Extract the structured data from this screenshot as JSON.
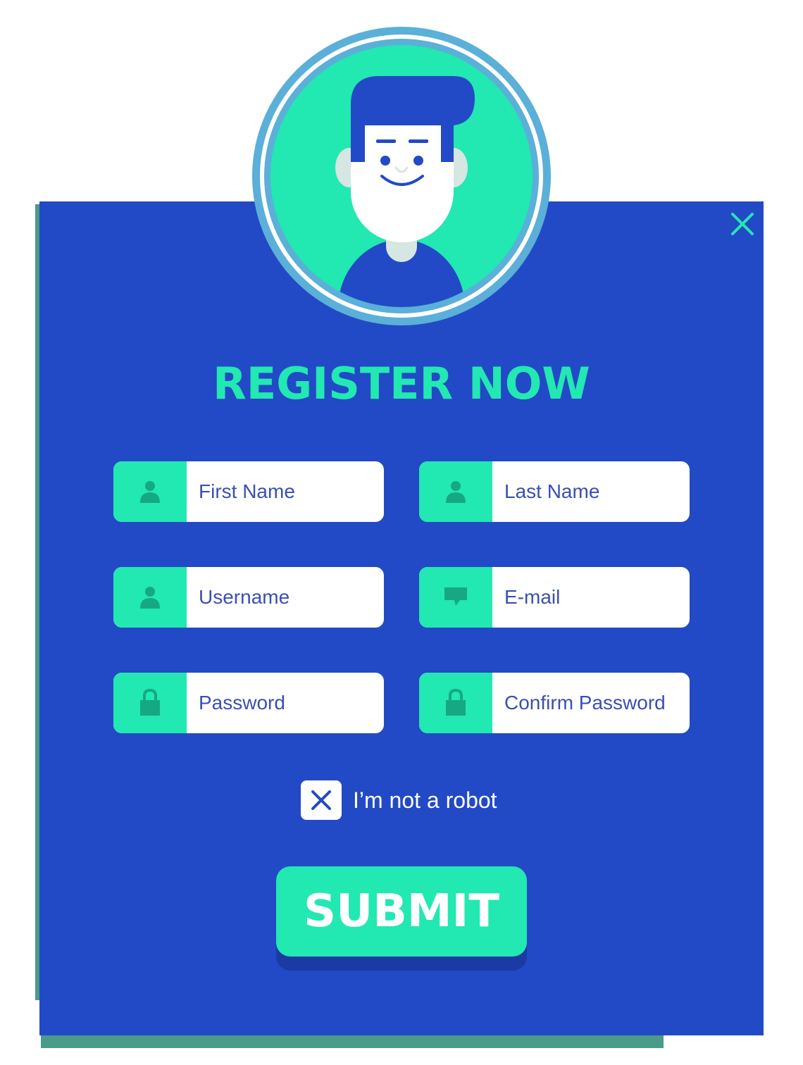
{
  "title": "REGISTER NOW",
  "fields": {
    "first_name": {
      "placeholder": "First Name",
      "icon": "user-icon"
    },
    "last_name": {
      "placeholder": "Last Name",
      "icon": "user-icon"
    },
    "username": {
      "placeholder": "Username",
      "icon": "user-icon"
    },
    "email": {
      "placeholder": "E-mail",
      "icon": "chat-bubble-icon"
    },
    "password": {
      "placeholder": "Password",
      "icon": "lock-icon"
    },
    "confirm_password": {
      "placeholder": "Confirm Password",
      "icon": "lock-icon"
    }
  },
  "captcha": {
    "label": "I’m not a robot",
    "checked": true
  },
  "submit_label": "SUBMIT",
  "colors": {
    "panel": "#224ac6",
    "accent": "#22e8b2",
    "shadow": "#4a9b87",
    "text": "#3a4fb3"
  }
}
